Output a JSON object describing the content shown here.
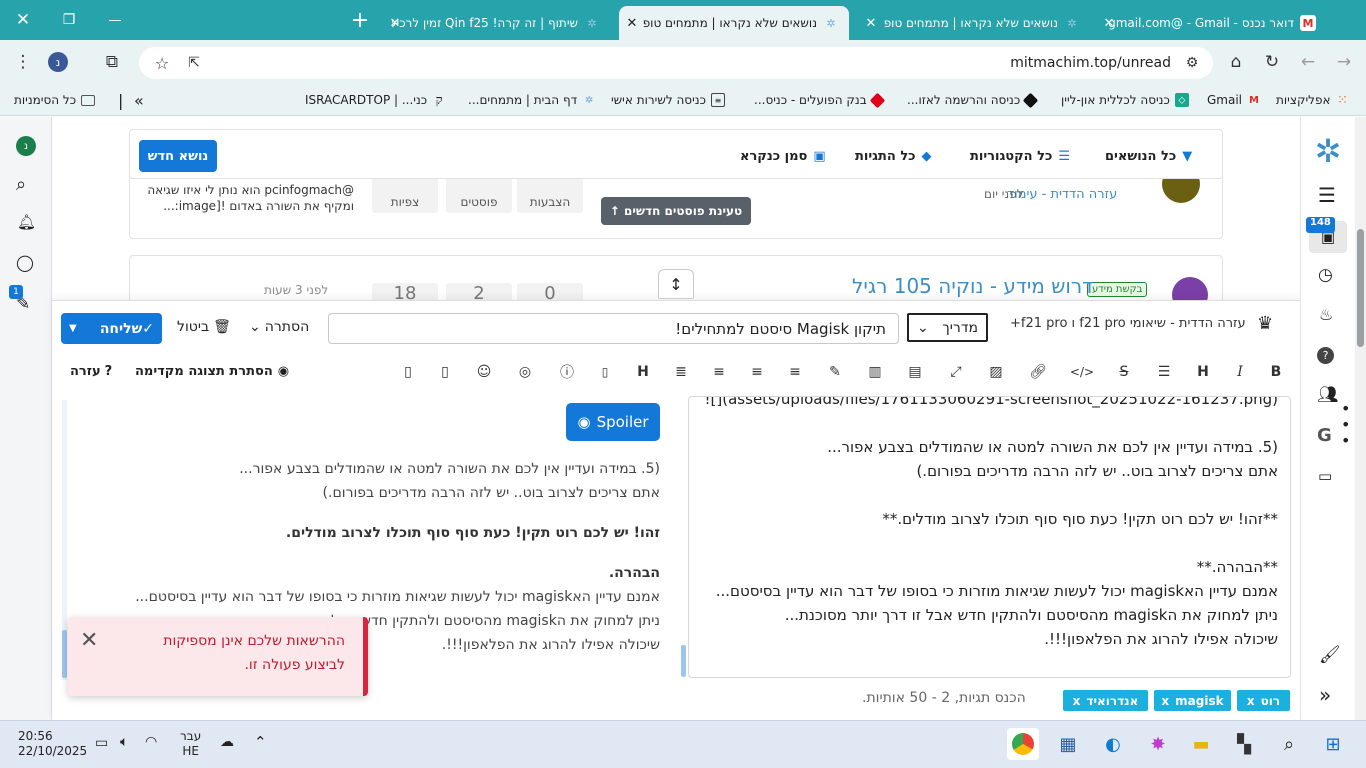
{
  "window": {
    "close_icon": "✕",
    "restore_icon": "❐",
    "minimize_icon": "—"
  },
  "tabs": [
    {
      "title": "דואר נכנס - Gmail - ‏@gmail.com",
      "favicon": "gmail",
      "active": false
    },
    {
      "title": "נושאים שלא נקראו | מתמחים טופ",
      "favicon": "mitmachim",
      "active": false
    },
    {
      "title": "נושאים שלא נקראו | מתמחים טופ",
      "favicon": "mitmachim",
      "active": true
    },
    {
      "title": "שיתוף | זה קרה! Qin f25 זמין לרכישה",
      "favicon": "mitmachim",
      "active": false
    }
  ],
  "new_tab_icon": "+",
  "address": {
    "url": "mitmachim.top/unread"
  },
  "bookmarks": [
    {
      "label": "אפליקציות",
      "icon": "apps"
    },
    {
      "label": "Gmail",
      "icon": "gmail"
    },
    {
      "label": "כניסה לכללית און-ליין",
      "icon": "clalit"
    },
    {
      "label": "כניסה והרשמה לאזו...",
      "icon": "diamond"
    },
    {
      "label": "בנק הפועלים - כניס...",
      "icon": "poalim"
    },
    {
      "label": "כניסה לשירות אישי",
      "icon": "page"
    },
    {
      "label": "דף הבית | מתמחים...",
      "icon": "mitmachim"
    },
    {
      "label": "כני... | ISRACARDTOP",
      "icon": "isracard"
    }
  ],
  "bookmarks_more": "»",
  "all_bookmarks": "כל הסימניות",
  "forum": {
    "filters": {
      "all_topics": "כל הנושאים",
      "all_categories": "כל הקטגוריות",
      "all_tags": "כל התגיות",
      "mark_read": "סמן כנקרא",
      "new_topic": "נושא חדש"
    },
    "load_new_posts": "טעינת פוסטים חדשים ↑",
    "row1": {
      "category": "עזרה הדדית - עימוד",
      "time": "לפני יום",
      "votes_label": "הצבעות",
      "posts_label": "פוסטים",
      "views_label": "צפיות",
      "preview": "@pcinfogmach הוא נותן לי איזו שגיאה ומקיף את השורה באדום ![image:..."
    },
    "row2": {
      "title": "דרוש מידע - נוקיה 105 רגיל",
      "badge": "בקשת מידע",
      "time": "לפני 3 שעות",
      "stats": [
        "0",
        "2",
        "18"
      ]
    },
    "unread_badge": "148",
    "chat_badge": "1"
  },
  "composer": {
    "category_label": "עזרה הדדית - שיאומי f21 pro ו f21 pro+",
    "topic_type": "מדריך",
    "title_value": "תיקון Magisk סיסטם למתחילים!",
    "hide": "הסתרה",
    "cancel": "ביטול",
    "send": "שליחה",
    "hide_preview": "הסתרת תצוגה מקדימה",
    "help": "עזרה",
    "editor_lines": [
      "![](assets/uploads/files/1761133060291-screenshot_20251022-161237.png)",
      "",
      "(5. במידה ועדיין אין לכם את השורה למטה או שהמודלים בצבע אפור...",
      "אתם צריכים לצרוב בוט.. יש לזה הרבה מדריכים בפורום.)",
      "",
      "**זהו! יש לכם רוט תקין! כעת סוף סוף תוכלו לצרוב מודלים.**",
      "",
      "**הבהרה.**",
      " אמנם עדיין האmagisk יכול לעשות שגיאות מוזרות כי בסופו של דבר הוא עדיין בסיסטם...",
      "ניתן למחוק את הmagisk מהסיסטם ולהתקין חדש אבל זו דרך יותר מסוכנת...",
      "שיכולה אפילו להרוג את הפלאפון!!!."
    ],
    "preview": {
      "spoiler": "Spoiler",
      "p1a": "(5. במידה ועדיין אין לכם את השורה למטה או שהמודלים בצבע אפור...",
      "p1b": "אתם צריכים לצרוב בוט.. יש לזה הרבה מדריכים בפורום.)",
      "p2": "זהו! יש לכם רוט תקין! כעת סוף סוף תוכלו לצרוב מודלים.",
      "p3": "הבהרה.",
      "p4a": "אמנם עדיין האmagisk יכול לעשות שגיאות מוזרות כי בסופו של דבר הוא עדיין בסיסטם...",
      "p4b": "ניתן למחוק את הmagisk מהסיסטם ולהתקין חדש אבל זו דרך יותר מסוכנת...",
      "p4c": "שיכולה אפילו להרוג את הפלאפון!!!."
    },
    "tags": [
      "רוט",
      "magisk",
      "אנדרואיד"
    ],
    "tags_hint": "הכנס תגיות, 2 - 50 אותיות."
  },
  "toast": {
    "message": "ההרשאות שלכם אינן מספיקות לביצוע פעולה זו."
  },
  "taskbar": {
    "time": "20:56",
    "date": "22/10/2025",
    "lang1": "עבר",
    "lang2": "HE"
  }
}
